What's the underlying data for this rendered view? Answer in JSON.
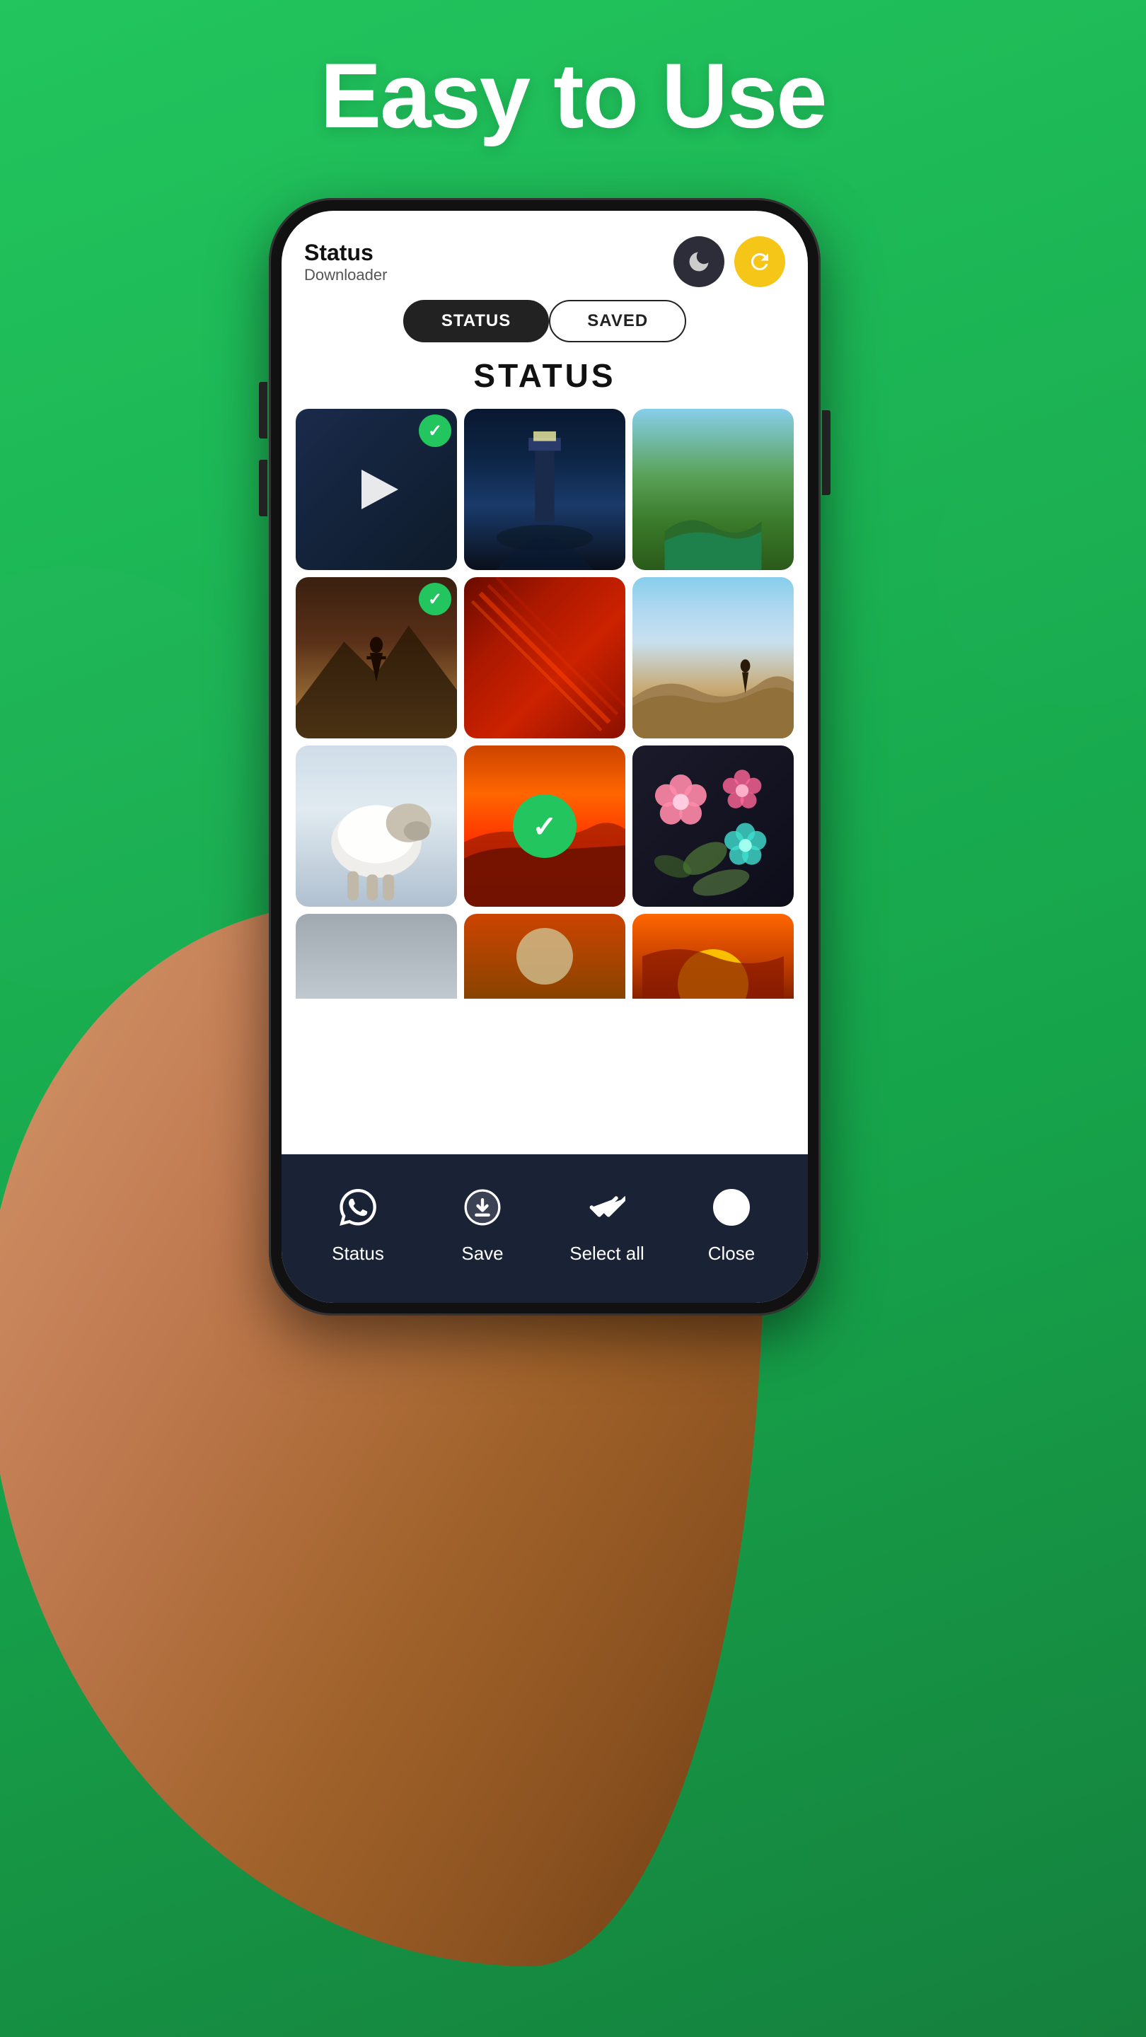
{
  "background": {
    "color": "#22c55e"
  },
  "header": {
    "title": "Easy to Use"
  },
  "app": {
    "name": "Status",
    "subtitle": "Downloader",
    "dark_icon": "🌙",
    "refresh_icon": "🔄",
    "tab_status": "STATUS",
    "tab_saved": "SAVED",
    "section_title": "STATUS"
  },
  "photos": [
    {
      "id": 1,
      "type": "video",
      "checked": true,
      "style": "dark-video"
    },
    {
      "id": 2,
      "type": "image",
      "checked": false,
      "style": "lighthouse"
    },
    {
      "id": 3,
      "type": "image",
      "checked": false,
      "style": "nature"
    },
    {
      "id": 4,
      "type": "image",
      "checked": true,
      "style": "silhouette"
    },
    {
      "id": 5,
      "type": "image",
      "checked": false,
      "style": "red-feather"
    },
    {
      "id": 6,
      "type": "image",
      "checked": false,
      "style": "mountain"
    },
    {
      "id": 7,
      "type": "image",
      "checked": false,
      "style": "sheep"
    },
    {
      "id": 8,
      "type": "image",
      "checked": true,
      "style": "center-check",
      "base": "sunset-mix"
    },
    {
      "id": 9,
      "type": "image",
      "checked": false,
      "style": "floral"
    }
  ],
  "bottom_nav": [
    {
      "id": "status",
      "label": "Status",
      "icon": "whatsapp"
    },
    {
      "id": "save",
      "label": "Save",
      "icon": "download"
    },
    {
      "id": "select_all",
      "label": "Select all",
      "icon": "checkmark-double"
    },
    {
      "id": "close",
      "label": "Close",
      "icon": "close-circle"
    }
  ]
}
